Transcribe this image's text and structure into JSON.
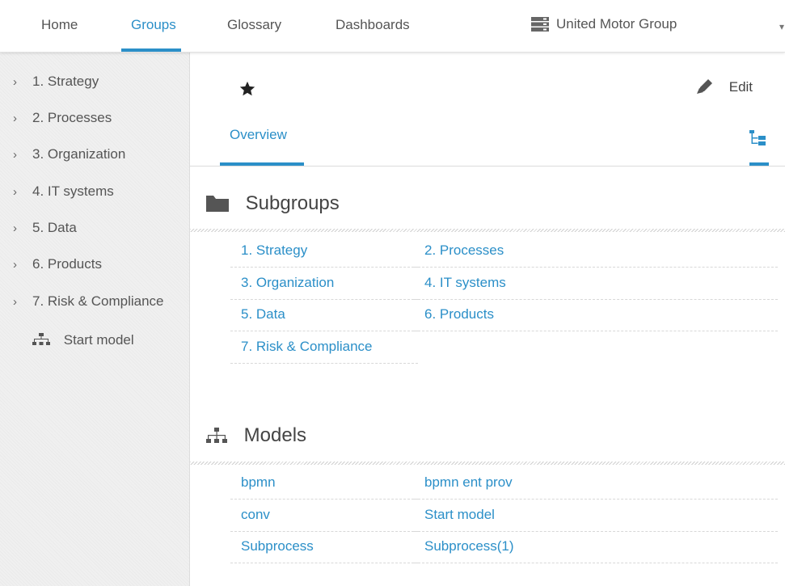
{
  "nav": {
    "tabs": [
      {
        "label": "Home"
      },
      {
        "label": "Groups"
      },
      {
        "label": "Glossary"
      },
      {
        "label": "Dashboards"
      }
    ],
    "active_tab": "Groups",
    "database": {
      "name": "United Motor Group",
      "icon": "database-icon"
    }
  },
  "sidebar": {
    "items": [
      {
        "label": "1. Strategy",
        "icon": "chevron-right-icon"
      },
      {
        "label": "2. Processes",
        "icon": "chevron-right-icon"
      },
      {
        "label": "3. Organization",
        "icon": "chevron-right-icon"
      },
      {
        "label": "4. IT systems",
        "icon": "chevron-right-icon"
      },
      {
        "label": "5. Data",
        "icon": "chevron-right-icon"
      },
      {
        "label": "6. Products",
        "icon": "chevron-right-icon"
      },
      {
        "label": "7. Risk & Compliance",
        "icon": "chevron-right-icon"
      }
    ],
    "start_model": {
      "label": "Start model",
      "icon": "model-hierarchy-icon"
    }
  },
  "main": {
    "favorite_icon": "star-icon",
    "edit": {
      "label": "Edit",
      "icon": "pencil-icon"
    },
    "tabs": {
      "overview": "Overview",
      "tree_icon": "tree-structure-icon"
    },
    "subgroups": {
      "title": "Subgroups",
      "icon": "folder-icon",
      "links": [
        "1. Strategy",
        "2. Processes",
        "3. Organization",
        "4. IT systems",
        "5. Data",
        "6. Products",
        "7. Risk & Compliance"
      ]
    },
    "models": {
      "title": "Models",
      "icon": "model-hierarchy-icon",
      "links": [
        "bpmn",
        "bpmn ent prov",
        "conv",
        "Start model",
        "Subprocess",
        "Subprocess(1)"
      ]
    }
  },
  "colors": {
    "accent": "#2b8fc8",
    "text": "#444444",
    "sidebar_bg": "#f0f0f0"
  }
}
